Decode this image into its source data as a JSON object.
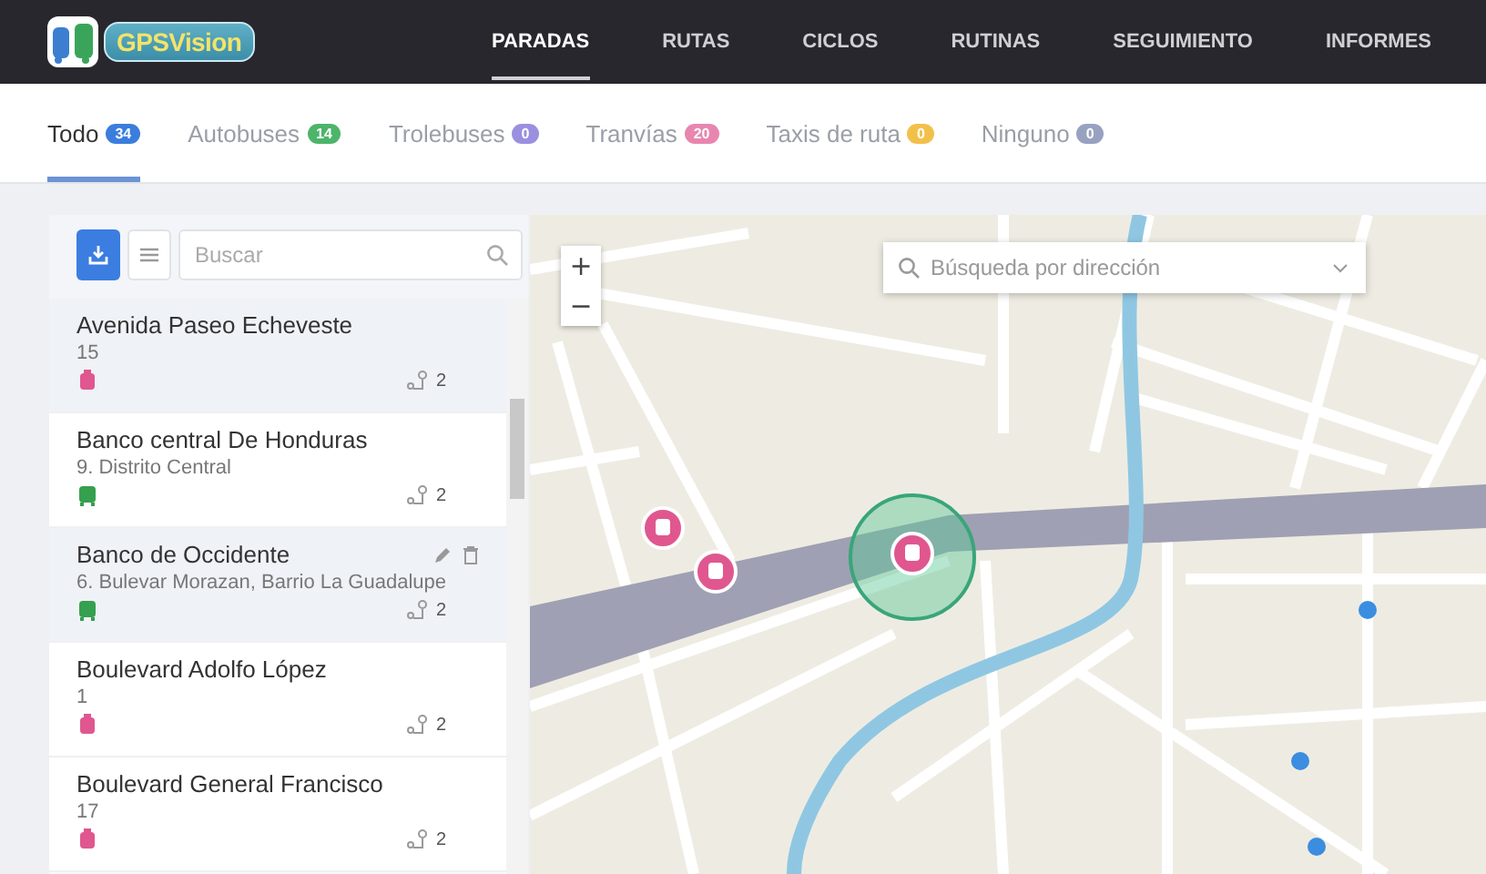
{
  "header": {
    "logo_text": "GPSVision",
    "nav": [
      {
        "label": "PARADAS",
        "selected": true
      },
      {
        "label": "RUTAS",
        "selected": false
      },
      {
        "label": "CICLOS",
        "selected": false
      },
      {
        "label": "RUTINAS",
        "selected": false
      },
      {
        "label": "SEGUIMIENTO",
        "selected": false
      },
      {
        "label": "INFORMES",
        "selected": false
      }
    ]
  },
  "filter_tabs": [
    {
      "label": "Todo",
      "count": "34",
      "color": "#3b7ddd",
      "selected": true
    },
    {
      "label": "Autobuses",
      "count": "14",
      "color": "#4cb56a",
      "selected": false
    },
    {
      "label": "Trolebuses",
      "count": "0",
      "color": "#9b8fe0",
      "selected": false
    },
    {
      "label": "Tranvías",
      "count": "20",
      "color": "#e886b0",
      "selected": false
    },
    {
      "label": "Taxis de ruta",
      "count": "0",
      "color": "#f2c04a",
      "selected": false
    },
    {
      "label": "Ninguno",
      "count": "0",
      "color": "#98a2c0",
      "selected": false
    }
  ],
  "sidebar": {
    "search": {
      "placeholder": "Buscar"
    },
    "stops": [
      {
        "name": "Avenida Paseo Echeveste",
        "detail": "15",
        "kind": "tram",
        "routes": "2",
        "selected": true,
        "actions_shown": false
      },
      {
        "name": "Banco central De Honduras",
        "detail": "9. Distrito Central",
        "kind": "bus",
        "routes": "2",
        "selected": false,
        "actions_shown": false
      },
      {
        "name": "Banco de Occidente",
        "detail": "6. Bulevar Morazan, Barrio La Guadalupe",
        "kind": "bus",
        "routes": "2",
        "selected": true,
        "actions_shown": true
      },
      {
        "name": "Boulevard Adolfo López",
        "detail": "1",
        "kind": "tram",
        "routes": "2",
        "selected": false,
        "actions_shown": false
      },
      {
        "name": "Boulevard General Francisco",
        "detail": "17",
        "kind": "tram",
        "routes": "2",
        "selected": false,
        "actions_shown": false
      }
    ]
  },
  "map": {
    "address_search": {
      "placeholder": "Búsqueda por dirección"
    },
    "zoom_in": "+",
    "zoom_out": "−"
  }
}
